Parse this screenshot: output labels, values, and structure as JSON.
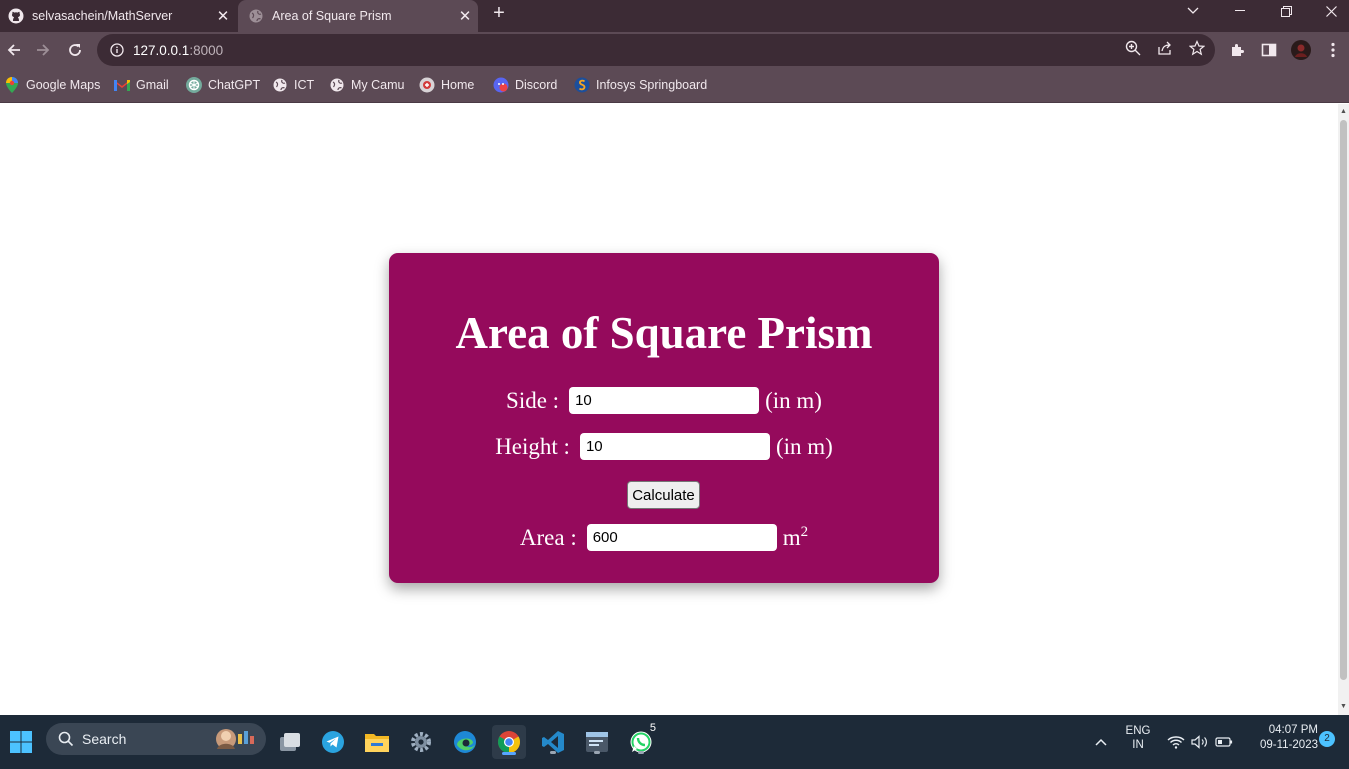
{
  "browser": {
    "tabs": [
      {
        "label": "selvasachein/MathServer",
        "icon": "github-icon"
      },
      {
        "label": "Area of Square Prism",
        "icon": "globe-icon"
      }
    ],
    "url_host": "127.0.0.1",
    "url_port": ":8000",
    "bookmarks": [
      {
        "label": "Google Maps",
        "icon": "maps-pin-icon"
      },
      {
        "label": "Gmail",
        "icon": "gmail-icon"
      },
      {
        "label": "ChatGPT",
        "icon": "chatgpt-icon"
      },
      {
        "label": "ICT",
        "icon": "globe-icon"
      },
      {
        "label": "My Camu",
        "icon": "globe-icon"
      },
      {
        "label": "Home",
        "icon": "home-site-icon"
      },
      {
        "label": "Discord",
        "icon": "discord-icon"
      },
      {
        "label": "Infosys Springboard",
        "icon": "springboard-icon"
      }
    ]
  },
  "app": {
    "title": "Area of Square Prism",
    "side_label": "Side :",
    "side_value": "10",
    "side_unit": "(in m)",
    "height_label": "Height :",
    "height_value": "10",
    "height_unit": "(in m)",
    "button_label": "Calculate",
    "area_label": "Area :",
    "area_value": "600",
    "area_unit_base": "m",
    "area_unit_exp": "2",
    "accent_color": "#950a5c"
  },
  "taskbar": {
    "search_label": "Search",
    "whatsapp_badge": "5",
    "lang_line1": "ENG",
    "lang_line2": "IN",
    "time": "04:07 PM",
    "date": "09-11-2023",
    "notification_count": "2"
  }
}
